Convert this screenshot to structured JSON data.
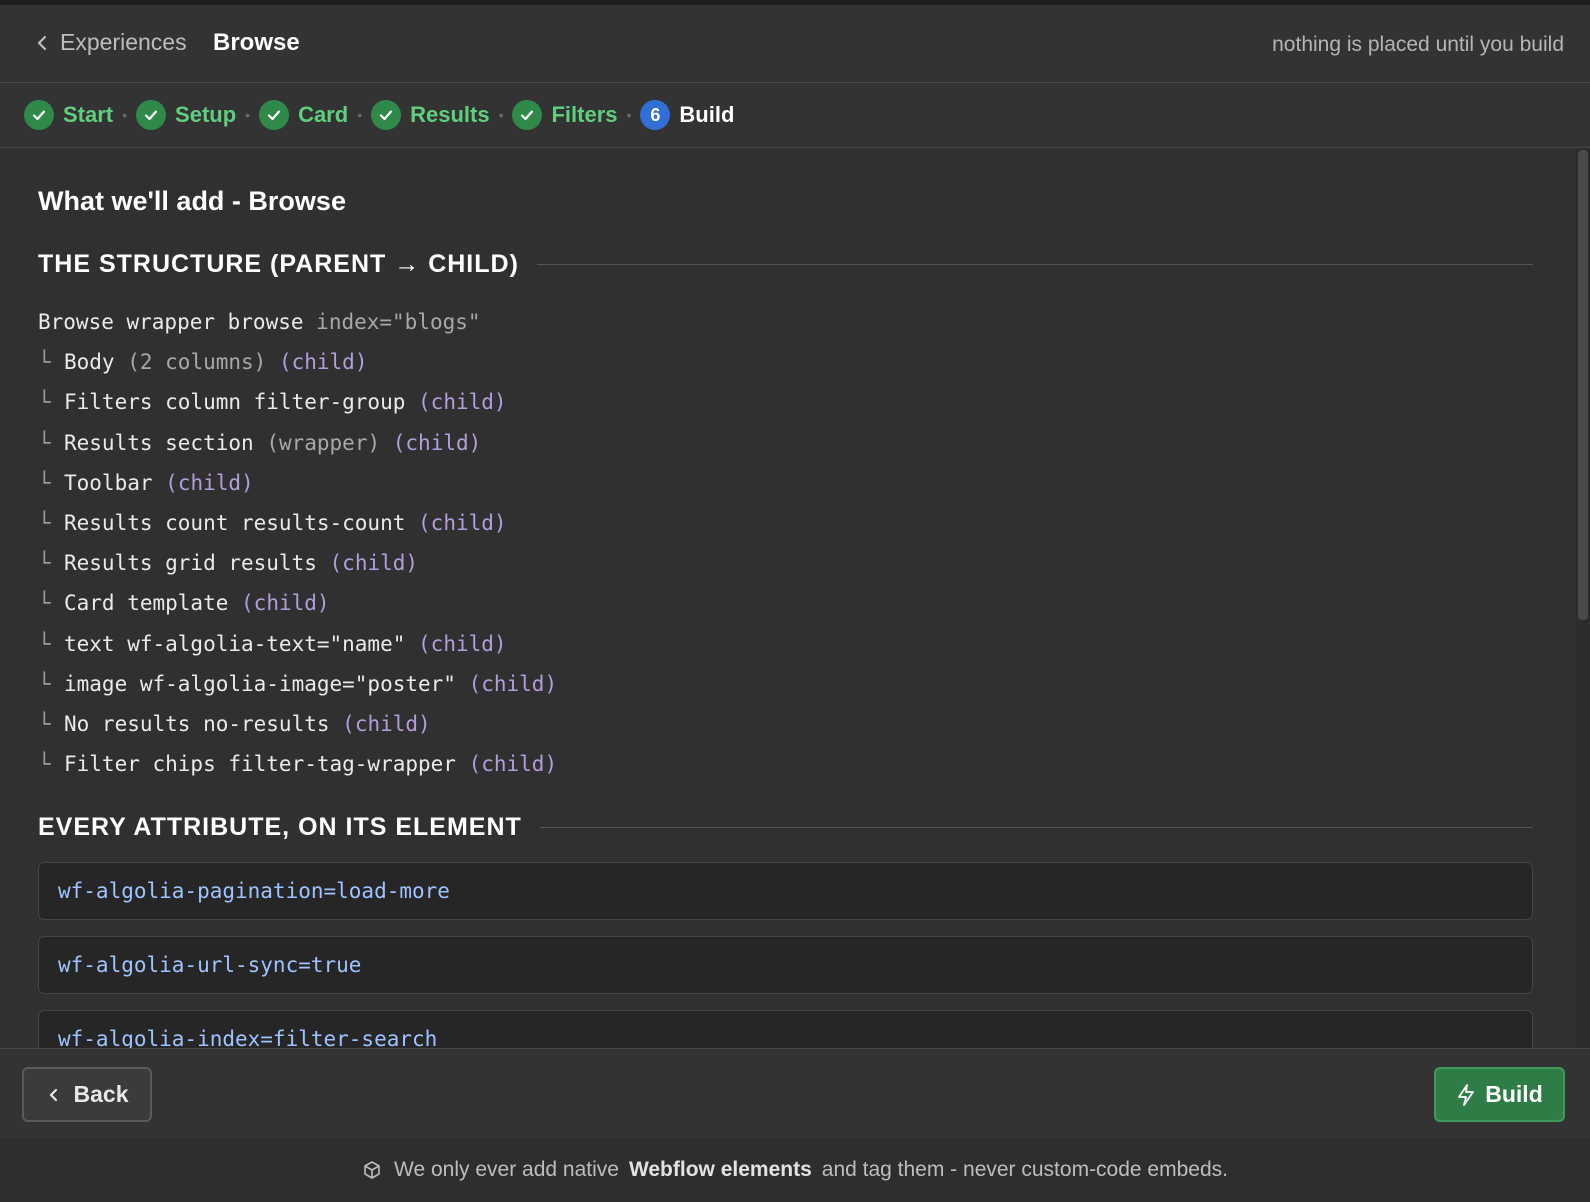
{
  "header": {
    "back_label": "Experiences",
    "current": "Browse",
    "note": "nothing is placed until you build"
  },
  "steps": [
    {
      "label": "Start",
      "state": "done"
    },
    {
      "label": "Setup",
      "state": "done"
    },
    {
      "label": "Card",
      "state": "done"
    },
    {
      "label": "Results",
      "state": "done"
    },
    {
      "label": "Filters",
      "state": "done"
    },
    {
      "label": "Build",
      "state": "active",
      "number": "6"
    }
  ],
  "main": {
    "title": "What we'll add - Browse",
    "structure_heading": "THE STRUCTURE (PARENT → CHILD)",
    "tree": {
      "root": {
        "name": "Browse wrapper browse",
        "attr": "index=\"blogs\""
      },
      "children": [
        {
          "name": "Body",
          "extra": "(2 columns)",
          "tag": "(child)"
        },
        {
          "name": "Filters column filter-group",
          "extra": "",
          "tag": "(child)"
        },
        {
          "name": "Results section",
          "extra": "(wrapper)",
          "tag": "(child)"
        },
        {
          "name": "Toolbar",
          "extra": "",
          "tag": "(child)"
        },
        {
          "name": "Results count results-count",
          "extra": "",
          "tag": "(child)"
        },
        {
          "name": "Results grid results",
          "extra": "",
          "tag": "(child)"
        },
        {
          "name": "Card template",
          "extra": "",
          "tag": "(child)"
        },
        {
          "name": "text wf-algolia-text=\"name\"",
          "extra": "",
          "tag": "(child)"
        },
        {
          "name": "image wf-algolia-image=\"poster\"",
          "extra": "",
          "tag": "(child)"
        },
        {
          "name": "No results no-results",
          "extra": "",
          "tag": "(child)"
        },
        {
          "name": "Filter chips filter-tag-wrapper",
          "extra": "",
          "tag": "(child)"
        }
      ]
    },
    "attributes_heading": "EVERY ATTRIBUTE, ON ITS ELEMENT",
    "attributes": [
      "wf-algolia-pagination=load-more",
      "wf-algolia-url-sync=true",
      "wf-algolia-index=filter-search"
    ]
  },
  "footer": {
    "back_button": "Back",
    "build_button": "Build"
  },
  "notice": {
    "before": "We only ever add native",
    "emphasis": "Webflow elements",
    "after": "and tag them - never custom-code embeds."
  },
  "colors": {
    "accent_green": "#5fcf7e",
    "step_active_blue": "#2f6fd6",
    "child_tag": "#b39ddb",
    "attr_text": "#9fc3ff"
  }
}
